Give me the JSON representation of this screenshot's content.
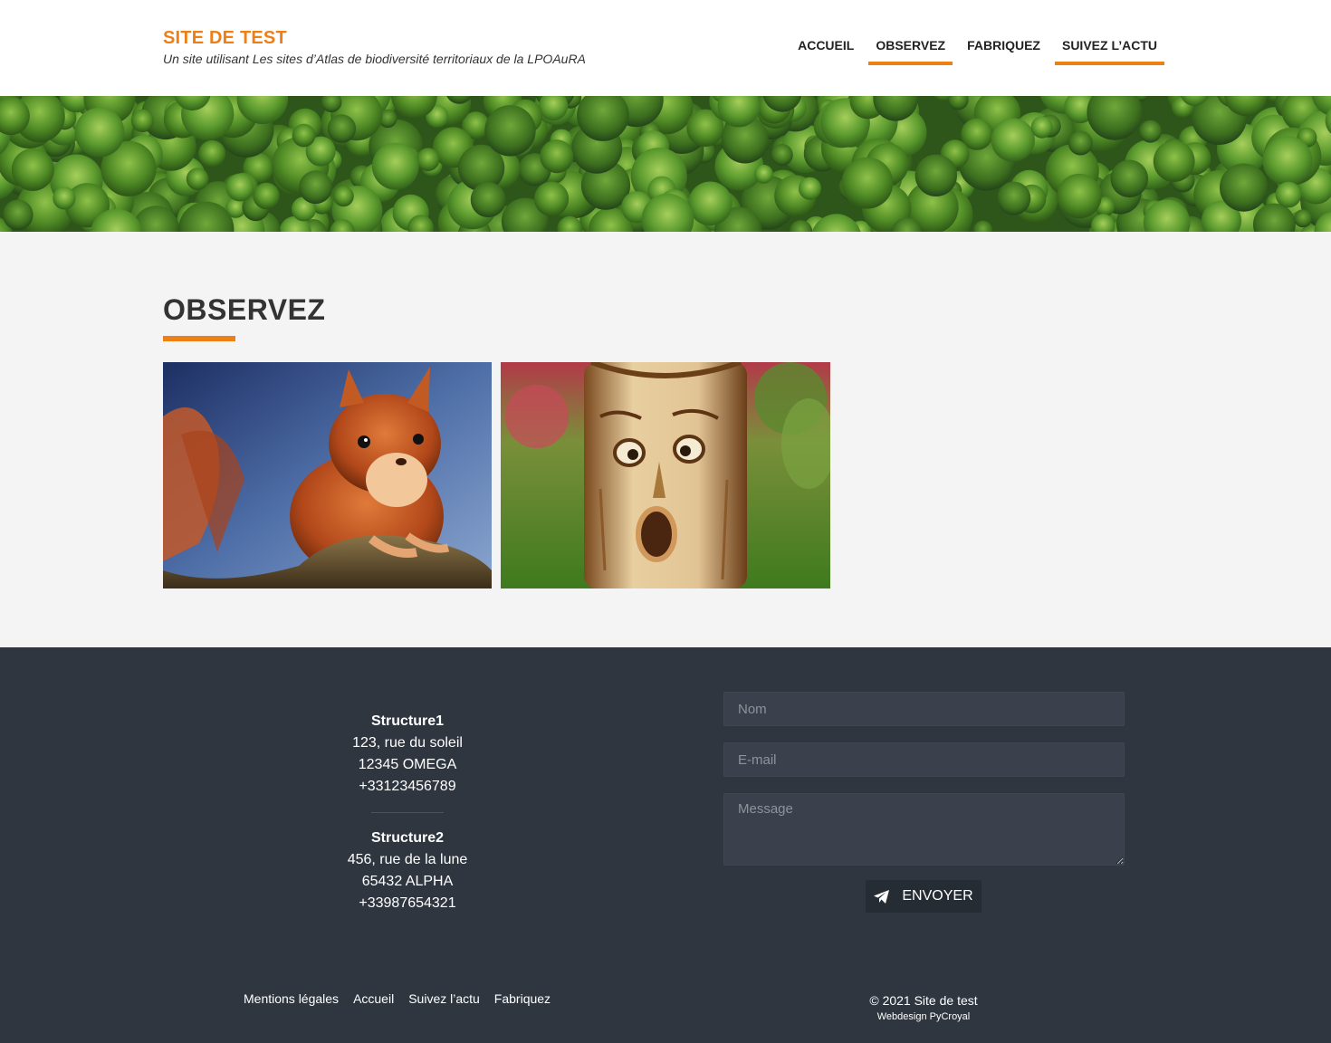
{
  "header": {
    "site_title": "SITE DE TEST",
    "tagline": "Un site utilisant Les sites d’Atlas de biodiversité territoriaux de la LPOAuRA",
    "nav": [
      {
        "label": "ACCUEIL",
        "active": false
      },
      {
        "label": "OBSERVEZ",
        "active": true
      },
      {
        "label": "FABRIQUEZ",
        "active": false
      },
      {
        "label": "SUIVEZ L’ACTU",
        "active": true
      }
    ]
  },
  "main": {
    "title": "OBSERVEZ"
  },
  "footer": {
    "structures": [
      {
        "name": "Structure1",
        "street": "123, rue du soleil",
        "city": "12345 OMEGA",
        "phone": "+33123456789"
      },
      {
        "name": "Structure2",
        "street": "456, rue de la lune",
        "city": "65432 ALPHA",
        "phone": "+33987654321"
      }
    ],
    "form": {
      "name_placeholder": "Nom",
      "email_placeholder": "E-mail",
      "message_placeholder": "Message",
      "send_label": "ENVOYER"
    },
    "links": [
      "Mentions légales",
      "Accueil",
      "Suivez l’actu",
      "Fabriquez"
    ],
    "copyright": "© 2021 Site de test",
    "credit": "Webdesign PyCroyal"
  },
  "colors": {
    "accent": "#ee7f14",
    "footer_bg": "#2f3640",
    "main_bg": "#f4f4f4"
  }
}
